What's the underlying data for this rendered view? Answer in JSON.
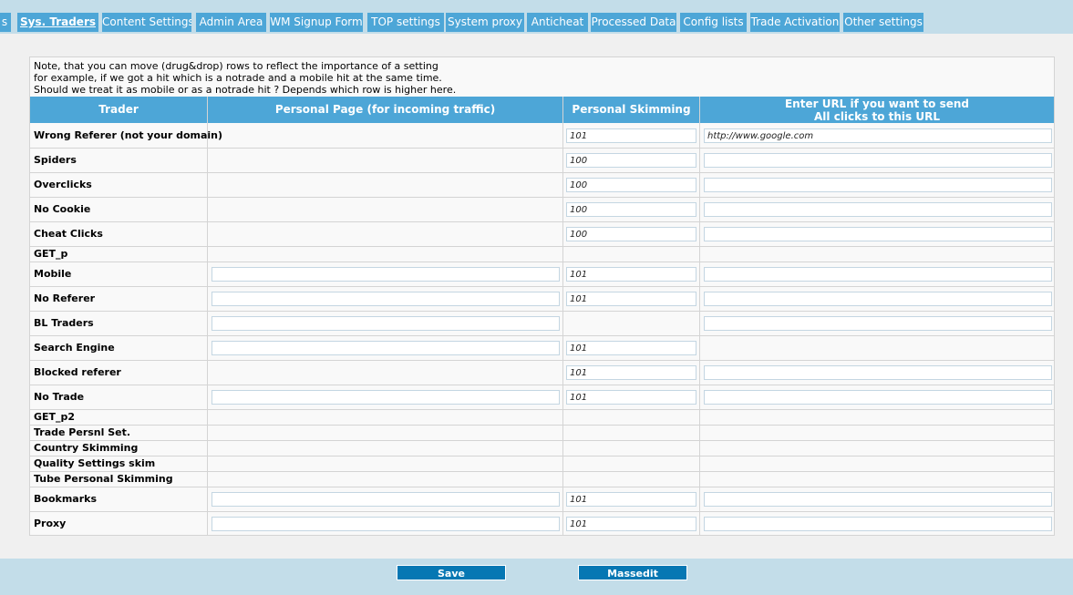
{
  "tabs": [
    {
      "label": "s",
      "active": false
    },
    {
      "label": "Sys. Traders",
      "active": true
    },
    {
      "label": "Content Settings",
      "active": false
    },
    {
      "label": "Admin Area",
      "active": false
    },
    {
      "label": "WM Signup Form",
      "active": false
    },
    {
      "label": "TOP settings",
      "active": false
    },
    {
      "label": "System proxy",
      "active": false
    },
    {
      "label": "Anticheat",
      "active": false
    },
    {
      "label": "Processed Data",
      "active": false
    },
    {
      "label": "Config lists",
      "active": false
    },
    {
      "label": "Trade Activation",
      "active": false
    },
    {
      "label": "Other settings",
      "active": false
    }
  ],
  "note": {
    "line1": "Note, that you can move (drug&drop) rows to reflect the importance of a setting",
    "line2": "for example, if we got a hit which is a notrade and a mobile hit at the same time.",
    "line3": "Should we treat it as mobile or as a notrade hit ? Depends which row is higher here."
  },
  "headers": {
    "trader": "Trader",
    "personal_page": "Personal Page (for incoming traffic)",
    "skimming": "Personal Skimming",
    "url_line1": "Enter URL if you want to send",
    "url_line2": "All clicks to this URL"
  },
  "rows": [
    {
      "label": "Wrong Referer (not your domain)",
      "page": null,
      "skim": "101",
      "url": "http://www.google.com"
    },
    {
      "label": "Spiders",
      "page": null,
      "skim": "100",
      "url": ""
    },
    {
      "label": "Overclicks",
      "page": null,
      "skim": "100",
      "url": ""
    },
    {
      "label": "No Cookie",
      "page": null,
      "skim": "100",
      "url": ""
    },
    {
      "label": "Cheat Clicks",
      "page": null,
      "skim": "100",
      "url": ""
    },
    {
      "label": "GET_p",
      "page": null,
      "skim": null,
      "url": null
    },
    {
      "label": "Mobile",
      "page": "",
      "skim": "101",
      "url": ""
    },
    {
      "label": "No Referer",
      "page": "",
      "skim": "101",
      "url": ""
    },
    {
      "label": "BL Traders",
      "page": "",
      "skim": null,
      "url": ""
    },
    {
      "label": "Search Engine",
      "page": "",
      "skim": "101",
      "url": null
    },
    {
      "label": "Blocked referer",
      "page": null,
      "skim": "101",
      "url": ""
    },
    {
      "label": "No Trade",
      "page": "",
      "skim": "101",
      "url": ""
    },
    {
      "label": "GET_p2",
      "page": null,
      "skim": null,
      "url": null
    },
    {
      "label": "Trade Persnl Set.",
      "page": null,
      "skim": null,
      "url": null
    },
    {
      "label": "Country Skimming",
      "page": null,
      "skim": null,
      "url": null
    },
    {
      "label": "Quality Settings skim",
      "page": null,
      "skim": null,
      "url": null
    },
    {
      "label": "Tube Personal Skimming",
      "page": null,
      "skim": null,
      "url": null
    },
    {
      "label": "Bookmarks",
      "page": "",
      "skim": "101",
      "url": ""
    },
    {
      "label": "Proxy",
      "page": "",
      "skim": "101",
      "url": ""
    }
  ],
  "buttons": {
    "save": "Save",
    "massedit": "Massedit"
  }
}
